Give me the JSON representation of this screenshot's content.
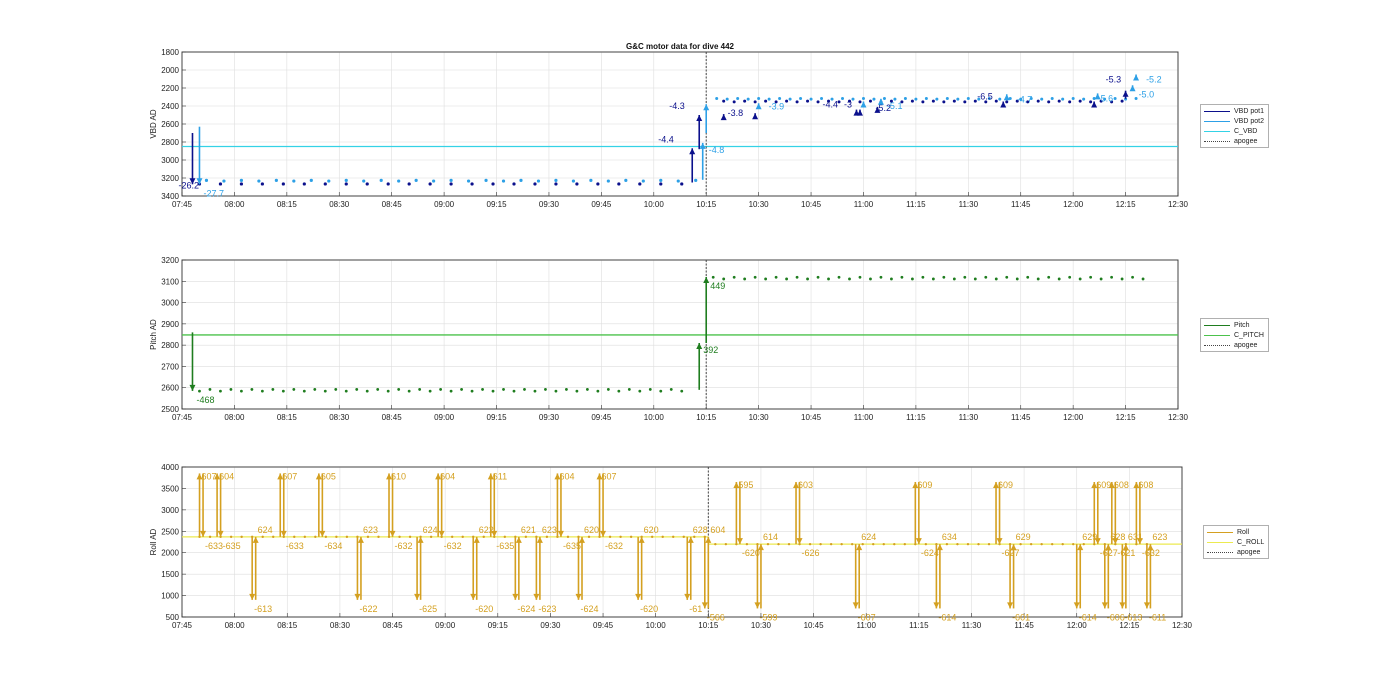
{
  "title": "G&C motor data for dive 442",
  "time_ticks": [
    "07:45",
    "08:00",
    "08:15",
    "08:30",
    "08:45",
    "09:00",
    "09:15",
    "09:30",
    "09:45",
    "10:00",
    "10:15",
    "10:30",
    "10:45",
    "11:00",
    "11:15",
    "11:30",
    "11:45",
    "12:00",
    "12:15",
    "12:30"
  ],
  "colors": {
    "vbd_pot1": "#0b108c",
    "vbd_pot2": "#2da0e6",
    "c_vbd": "#34d2e6",
    "pitch": "#1f7d1f",
    "c_pitch": "#4cc24c",
    "roll": "#d4a020",
    "c_roll": "#ecea50",
    "apogee": "#444444"
  },
  "chart_data": [
    {
      "type": "scatter",
      "id": "vbd",
      "title": "G&C motor data for dive 442",
      "ylabel": "VBD AD",
      "xlabel": "",
      "xlim": [
        "07:45",
        "12:30"
      ],
      "ylim": [
        3400,
        1800
      ],
      "y_reversed": true,
      "yticks": [
        1800,
        2000,
        2200,
        2400,
        2600,
        2800,
        3000,
        3200,
        3400
      ],
      "grid": true,
      "legend_position": "right",
      "legend": [
        "VBD pot1",
        "VBD pot2",
        "C_VBD",
        "apogee"
      ],
      "c_vbd": 2850,
      "apogee": "10:15",
      "moves": [
        {
          "t": "07:48",
          "from": 2700,
          "to": 3270,
          "rate": "-26.2",
          "series": "pot1",
          "label_at": [
            -14,
            4
          ]
        },
        {
          "t": "07:50",
          "from": 2630,
          "to": 3270,
          "rate": "-27.7",
          "series": "pot2",
          "label_at": [
            4,
            12
          ]
        },
        {
          "t": "10:11",
          "from": 3250,
          "to": 2870,
          "rate": "-4.4",
          "series": "pot1",
          "label_at": [
            -34,
            -6
          ]
        },
        {
          "t": "10:13",
          "from": 2880,
          "to": 2500,
          "rate": "-4.3",
          "series": "pot1",
          "label_at": [
            -30,
            -6
          ]
        },
        {
          "t": "10:14",
          "from": 3220,
          "to": 2810,
          "rate": "-4.8",
          "series": "pot2",
          "label_at": [
            6,
            10
          ]
        },
        {
          "t": "10:15",
          "from": 2700,
          "to": 2380,
          "rate": "",
          "series": "pot2",
          "label_at": [
            0,
            0
          ]
        },
        {
          "t": "10:20",
          "from": 2510,
          "to": 2490,
          "rate": "-3.8",
          "series": "pot1",
          "label_at": [
            4,
            2
          ]
        },
        {
          "t": "10:29",
          "from": 2500,
          "to": 2480,
          "rate": "",
          "series": "pot1",
          "label_at": [
            0,
            0
          ]
        },
        {
          "t": "10:30",
          "from": 2400,
          "to": 2370,
          "rate": "-3.9",
          "series": "pot2",
          "label_at": [
            10,
            6
          ]
        },
        {
          "t": "10:58",
          "from": 2470,
          "to": 2440,
          "rate": "-4.4",
          "series": "pot1",
          "label_at": [
            -34,
            -2
          ]
        },
        {
          "t": "10:59",
          "from": 2470,
          "to": 2440,
          "rate": "-3",
          "series": "pot1",
          "label_at": [
            -16,
            -2
          ]
        },
        {
          "t": "11:00",
          "from": 2380,
          "to": 2350,
          "rate": "",
          "series": "pot2",
          "label_at": [
            0,
            0
          ]
        },
        {
          "t": "11:04",
          "from": 2440,
          "to": 2410,
          "rate": "-5.2",
          "series": "pot1",
          "label_at": [
            -2,
            4
          ]
        },
        {
          "t": "11:05",
          "from": 2350,
          "to": 2320,
          "rate": "-5.1",
          "series": "pot2",
          "label_at": [
            6,
            10
          ]
        },
        {
          "t": "11:40",
          "from": 2380,
          "to": 2350,
          "rate": "-6.5",
          "series": "pot1",
          "label_at": [
            -26,
            -2
          ]
        },
        {
          "t": "11:41",
          "from": 2300,
          "to": 2270,
          "rate": "-4.7",
          "series": "pot2",
          "label_at": [
            10,
            8
          ]
        },
        {
          "t": "12:06",
          "from": 2380,
          "to": 2350,
          "rate": "",
          "series": "pot1",
          "label_at": [
            0,
            0
          ]
        },
        {
          "t": "12:07",
          "from": 2290,
          "to": 2260,
          "rate": "-5.6",
          "series": "pot2",
          "label_at": [
            0,
            8
          ]
        },
        {
          "t": "12:15",
          "from": 2320,
          "to": 2230,
          "rate": "-5.3",
          "series": "pot1",
          "label_at": [
            -20,
            -8
          ]
        },
        {
          "t": "12:17",
          "from": 2200,
          "to": 2170,
          "rate": "-5.0",
          "series": "pot2",
          "label_at": [
            6,
            12
          ]
        },
        {
          "t": "12:18",
          "from": 2100,
          "to": 2050,
          "rate": "-5.2",
          "series": "pot2",
          "label_at": [
            10,
            8
          ]
        }
      ],
      "dots": {
        "pot1": {
          "start": "07:50",
          "end": "10:12",
          "value": 3270,
          "step": 6
        },
        "pot2": {
          "start": "07:52",
          "end": "10:12",
          "value": 3230,
          "step": 5
        },
        "pot1_after": {
          "start": "10:20",
          "end": "12:15",
          "value": 2350,
          "step": 3
        },
        "pot2_after": {
          "start": "10:18",
          "end": "12:20",
          "value": 2320,
          "step": 3
        }
      }
    },
    {
      "type": "scatter",
      "id": "pitch",
      "ylabel": "Pitch AD",
      "xlabel": "",
      "xlim": [
        "07:45",
        "12:30"
      ],
      "ylim": [
        2500,
        3200
      ],
      "yticks": [
        2500,
        2600,
        2700,
        2800,
        2900,
        3000,
        3100,
        3200
      ],
      "grid": true,
      "legend_position": "right",
      "legend": [
        "Pitch",
        "C_PITCH",
        "apogee"
      ],
      "c_pitch": 2848,
      "apogee": "10:15",
      "moves": [
        {
          "t": "07:48",
          "from": 2860,
          "to": 2585,
          "rate": "-468",
          "label_at": [
            4,
            12
          ]
        },
        {
          "t": "10:13",
          "from": 2590,
          "to": 2810,
          "rate": "392",
          "label_at": [
            4,
            10
          ]
        },
        {
          "t": "10:15",
          "from": 2810,
          "to": 3120,
          "rate": "449",
          "label_at": [
            4,
            12
          ]
        }
      ],
      "dots_before": {
        "start": "07:50",
        "end": "10:10",
        "value": 2588,
        "step": 3
      },
      "dots_after": {
        "start": "10:17",
        "end": "12:20",
        "value": 3115,
        "step": 3
      }
    },
    {
      "type": "scatter",
      "id": "roll",
      "ylabel": "Roll AD",
      "xlabel": "",
      "xlim": [
        "07:45",
        "12:30"
      ],
      "ylim": [
        500,
        4000
      ],
      "yticks": [
        500,
        1000,
        1500,
        2000,
        2500,
        3000,
        3500,
        4000
      ],
      "grid": true,
      "legend_position": "right",
      "legend": [
        "Roll",
        "C_ROLL",
        "apogee"
      ],
      "c_roll": 2370,
      "c_roll_after": 2200,
      "apogee": "10:15",
      "base": 2370,
      "base_after": 2200,
      "excursions": [
        {
          "t": "07:50",
          "peak": 3850,
          "out": "607",
          "back": "-633"
        },
        {
          "t": "07:55",
          "peak": 3850,
          "out": "604",
          "back": "-635"
        },
        {
          "t": "08:05",
          "peak": 900,
          "out": "-613",
          "back": "624"
        },
        {
          "t": "08:13",
          "peak": 3850,
          "out": "607",
          "back": "-633"
        },
        {
          "t": "08:24",
          "peak": 3850,
          "out": "605",
          "back": "-634"
        },
        {
          "t": "08:35",
          "peak": 900,
          "out": "-622",
          "back": "623"
        },
        {
          "t": "08:44",
          "peak": 3850,
          "out": "610",
          "back": "-632"
        },
        {
          "t": "08:52",
          "peak": 900,
          "out": "-625",
          "back": "624"
        },
        {
          "t": "08:58",
          "peak": 3850,
          "out": "604",
          "back": "-632"
        },
        {
          "t": "09:08",
          "peak": 900,
          "out": "-620",
          "back": "622"
        },
        {
          "t": "09:13",
          "peak": 3850,
          "out": "611",
          "back": "-635"
        },
        {
          "t": "09:20",
          "peak": 900,
          "out": "-624",
          "back": "621"
        },
        {
          "t": "09:26",
          "peak": 900,
          "out": "-623",
          "back": "623"
        },
        {
          "t": "09:32",
          "peak": 3850,
          "out": "604",
          "back": "-635"
        },
        {
          "t": "09:38",
          "peak": 900,
          "out": "-624",
          "back": "620"
        },
        {
          "t": "09:44",
          "peak": 3850,
          "out": "607",
          "back": "-632"
        },
        {
          "t": "09:55",
          "peak": 900,
          "out": "-620",
          "back": "620"
        },
        {
          "t": "10:09",
          "peak": 900,
          "out": "-61",
          "back": "628"
        },
        {
          "t": "10:14",
          "peak": 700,
          "out": "-566",
          "back": "604"
        },
        {
          "t": "10:23",
          "peak": 3650,
          "out": "595",
          "back": "-620"
        },
        {
          "t": "10:29",
          "peak": 700,
          "out": "-599",
          "back": "614"
        },
        {
          "t": "10:40",
          "peak": 3650,
          "out": "603",
          "back": "-626"
        },
        {
          "t": "10:57",
          "peak": 700,
          "out": "-607",
          "back": "624"
        },
        {
          "t": "11:14",
          "peak": 3650,
          "out": "609",
          "back": "-624"
        },
        {
          "t": "11:20",
          "peak": 700,
          "out": "-614",
          "back": "634"
        },
        {
          "t": "11:37",
          "peak": 3650,
          "out": "609",
          "back": "-627"
        },
        {
          "t": "11:41",
          "peak": 700,
          "out": "-601",
          "back": "629"
        },
        {
          "t": "12:00",
          "peak": 700,
          "out": "-614",
          "back": "629"
        },
        {
          "t": "12:05",
          "peak": 3650,
          "out": "609",
          "back": "-627"
        },
        {
          "t": "12:08",
          "peak": 700,
          "out": "-606",
          "back": "628"
        },
        {
          "t": "12:10",
          "peak": 3650,
          "out": "608",
          "back": "-621"
        },
        {
          "t": "12:13",
          "peak": 700,
          "out": "-613",
          "back": "631"
        },
        {
          "t": "12:17",
          "peak": 3650,
          "out": "608",
          "back": "-632"
        },
        {
          "t": "12:20",
          "peak": 700,
          "out": "-611",
          "back": "623"
        }
      ]
    }
  ]
}
